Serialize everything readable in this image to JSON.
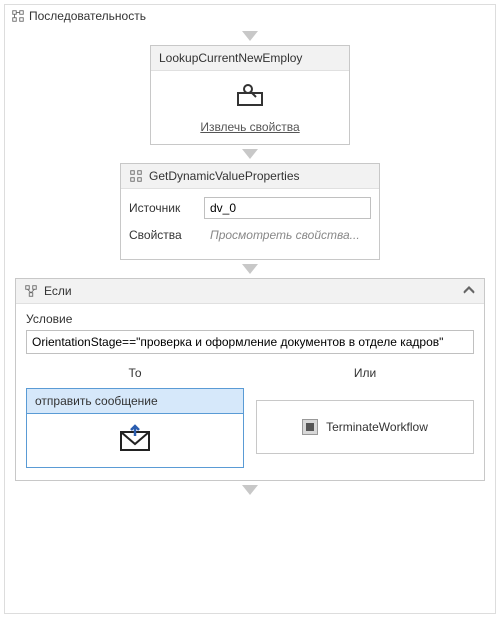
{
  "sequence": {
    "title": "Последовательность"
  },
  "lookup": {
    "title": "LookupCurrentNewEmploy",
    "link": "Извлечь свойства"
  },
  "getDynamic": {
    "title": "GetDynamicValueProperties",
    "source_label": "Источник",
    "source_value": "dv_0",
    "props_label": "Свойства",
    "props_placeholder": "Просмотреть свойства..."
  },
  "ifBlock": {
    "title": "Если",
    "condition_label": "Условие",
    "condition_value": "OrientationStage==\"проверка и оформление документов в отделе кадров\"",
    "then_label": "То",
    "else_label": "Или",
    "then_activity_title": "отправить сообщение",
    "else_activity_title": "TerminateWorkflow"
  }
}
